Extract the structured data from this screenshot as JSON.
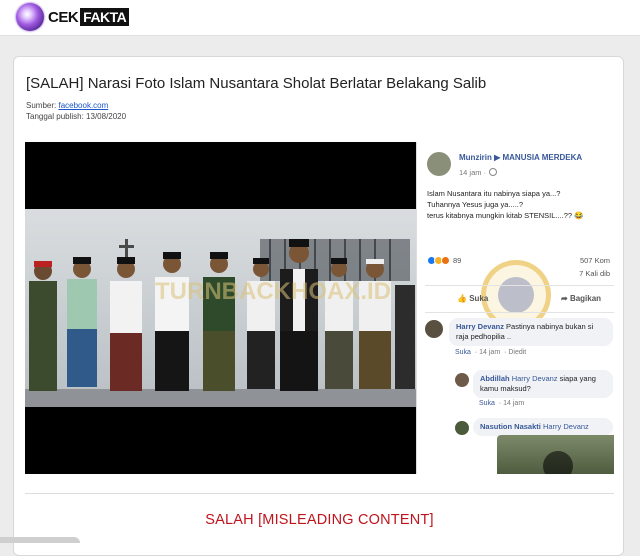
{
  "header": {
    "logo_icon": "cekfakta-orb-logo",
    "logo_text_1": "CEK",
    "logo_text_2": "FAKTA"
  },
  "article": {
    "title": "[SALAH] Narasi Foto Islam Nusantara Sholat Berlatar Belakang Salib",
    "source_label": "Sumber: ",
    "source_link": "facebook.com",
    "publish_label": "Tanggal publish: 13/08/2020",
    "verdict": "SALAH [MISLEADING CONTENT]"
  },
  "facebook_post": {
    "author": "Munzirin ▶ MANUSIA MERDEKA",
    "time": "14 jam ·",
    "text": "Islam Nusantara itu nabinya siapa ya...?\nTuhannya Yesus juga ya.....?\nterus kitabnya mungkin kitab STENSIL....?? 😂",
    "reactions_count": "89",
    "comments_count": "507 Kom",
    "shares_count": "7 Kali dib",
    "like_label": "Suka",
    "share_label": "Bagikan",
    "comments": [
      {
        "name": "Harry Devanz",
        "text": "Pastinya nabinya bukan si raja pedhopilia ..",
        "actions": [
          "Suka",
          "14 jam",
          "Diedit"
        ]
      },
      {
        "name": "Abdillah",
        "mention": "Harry Devanz",
        "text": "siapa yang kamu maksud?",
        "actions": [
          "Suka",
          "14 jam"
        ]
      },
      {
        "name": "Nasution Nasakti",
        "mention": "Harry Devanz",
        "text": "",
        "actions": []
      }
    ],
    "photo_watermark": "TURNBACKHOAX.ID"
  },
  "colors": {
    "verdict_red": "#c0141d",
    "fb_blue": "#385898",
    "link_blue": "#1a55c9"
  }
}
